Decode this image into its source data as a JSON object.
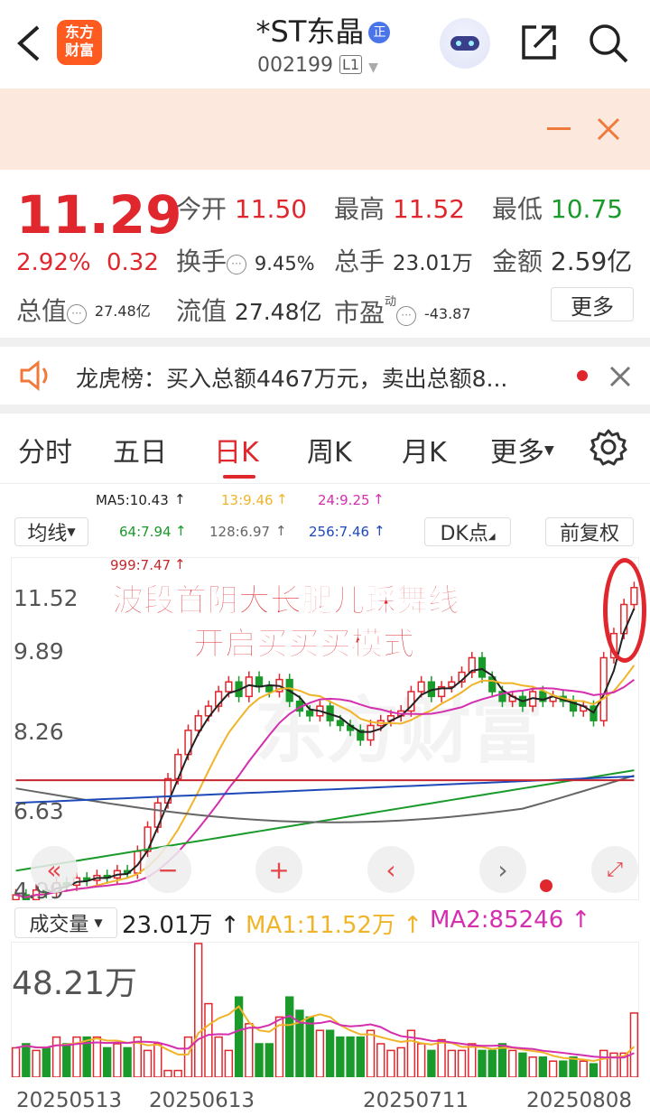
{
  "header": {
    "logo_line1": "东方",
    "logo_line2": "财富",
    "stock_name": "*ST东晶",
    "badge": "正",
    "code": "002199",
    "level": "L1"
  },
  "quote": {
    "price": "11.29",
    "change_pct": "2.92%",
    "change_amt": "0.32",
    "open_label": "今开",
    "open": "11.50",
    "high_label": "最高",
    "high": "11.52",
    "low_label": "最低",
    "low": "10.75",
    "turnover_label": "换手",
    "turnover": "9.45%",
    "volume_label": "总手",
    "volume": "23.01万",
    "amount_label": "金额",
    "amount": "2.59亿",
    "mcap_label": "总值",
    "mcap": "27.48亿",
    "float_label": "流值",
    "float": "27.48亿",
    "pe_label": "市盈",
    "pe_sup": "动",
    "pe": "-43.87",
    "more_label": "更多"
  },
  "dragon": {
    "text": "龙虎榜：买入总额4467万元，卖出总额8..."
  },
  "tabs": [
    "分时",
    "五日",
    "日K",
    "周K",
    "月K",
    "更多"
  ],
  "active_tab": "日K",
  "ma": {
    "ma5": "MA5:10.43",
    "ma13": "13:9.46",
    "ma24": "24:9.25",
    "ma64": "64:7.94",
    "ma128": "128:6.97",
    "ma256": "256:7.46",
    "ma999": "999:7.47"
  },
  "controls": {
    "avg_line": "均线",
    "dk": "DK点",
    "adjust": "前复权"
  },
  "annotation": {
    "line1": "波段首阴大长腿儿踩舞线",
    "line2": "开启买买买模式"
  },
  "price_axis": [
    "11.52",
    "9.89",
    "8.26",
    "6.63",
    "4.99"
  ],
  "volume": {
    "selector": "成交量",
    "value": "23.01万",
    "ma1": "MA1:11.52万",
    "ma2": "MA2:85246",
    "max": "48.21万"
  },
  "dates": [
    "20250513",
    "20250613",
    "20250711",
    "20250808"
  ],
  "colors": {
    "up": "#e0272d",
    "down": "#1a9a2a",
    "brand": "#ff5a1f",
    "ma5": "#222222",
    "ma13": "#f0b429",
    "ma24": "#d42fae",
    "ma64": "#1a9a2a",
    "ma128": "#666666",
    "ma256": "#1e49b8",
    "ma999": "#c4282e"
  }
}
